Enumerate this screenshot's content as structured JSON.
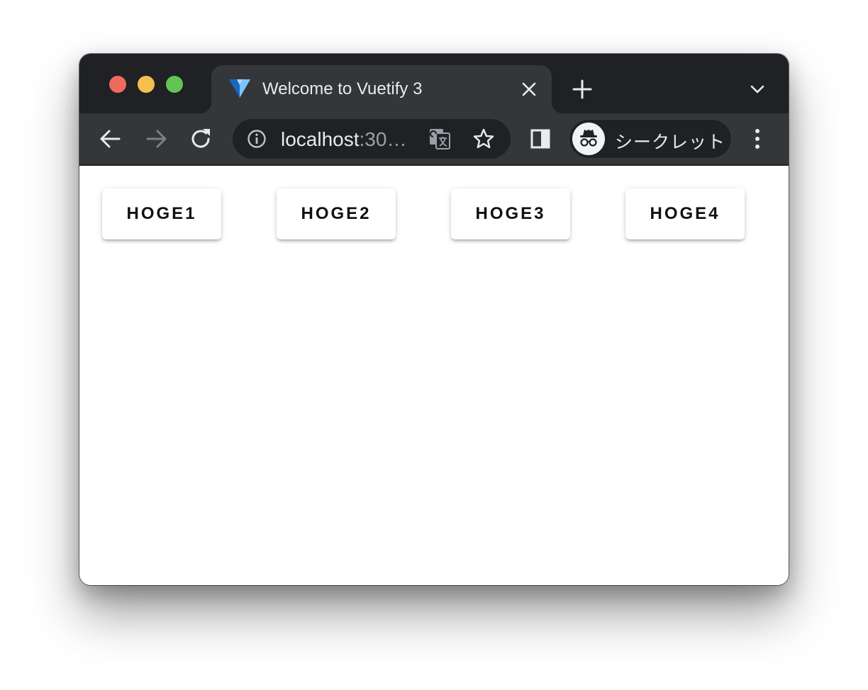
{
  "browser": {
    "tab": {
      "title": "Welcome to Vuetify 3",
      "favicon": "vuetify-logo-icon"
    },
    "toolbar": {
      "url_host": "localhost",
      "url_rest": ":30…",
      "profile_label": "シークレット"
    },
    "colors": {
      "tabstrip": "#202124",
      "toolbar": "#35363a",
      "close_button": "#ed6a5e",
      "minimize_button": "#f5bf4f",
      "maximize_button": "#61c554"
    }
  },
  "page": {
    "buttons": [
      {
        "label": "HOGE1"
      },
      {
        "label": "HOGE2"
      },
      {
        "label": "HOGE3"
      },
      {
        "label": "HOGE4"
      }
    ]
  }
}
